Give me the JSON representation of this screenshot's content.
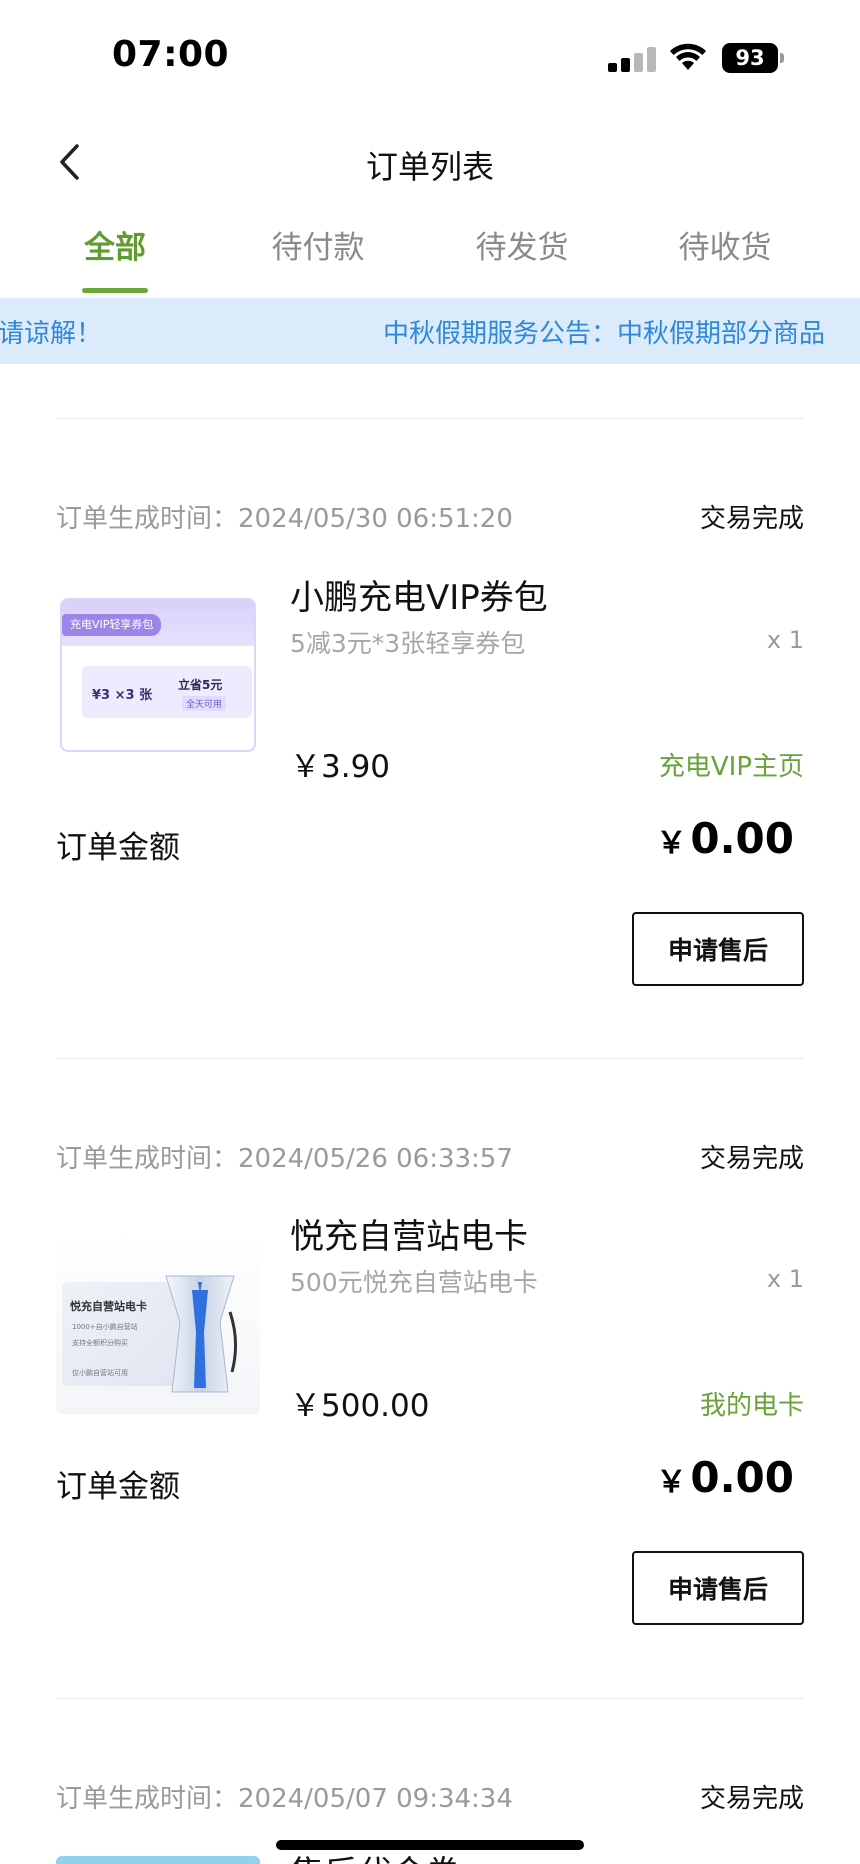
{
  "status_bar": {
    "time": "07:00",
    "battery": "93"
  },
  "nav": {
    "title": "订单列表"
  },
  "tabs": [
    {
      "label": "全部",
      "active": true
    },
    {
      "label": "待付款",
      "active": false
    },
    {
      "label": "待发货",
      "active": false
    },
    {
      "label": "待收货",
      "active": false
    }
  ],
  "notice": {
    "text_tail": "请谅解！",
    "text_head": "中秋假期服务公告：中秋假期部分商品"
  },
  "orders": [
    {
      "time": "订单生成时间：2024/05/30 06:51:20",
      "status": "交易完成",
      "product": "小鹏充电VIP券包",
      "desc": "5减3元*3张轻享券包",
      "qty": "x 1",
      "price": "￥3.90",
      "link": "充电VIP主页",
      "amount_label": "订单金额",
      "amount_currency": "￥",
      "amount_value": "0.00",
      "button": "申请售后",
      "thumb": {
        "tag": "充电VIP轻享券包",
        "coupon_left": "¥3 ×3 张",
        "coupon_right": "立省5元",
        "coupon_note": "全天可用"
      }
    },
    {
      "time": "订单生成时间：2024/05/26 06:33:57",
      "status": "交易完成",
      "product": "悦充自营站电卡",
      "desc": "500元悦充自营站电卡",
      "qty": "x 1",
      "price": "￥500.00",
      "link": "我的电卡",
      "amount_label": "订单金额",
      "amount_currency": "￥",
      "amount_value": "0.00",
      "button": "申请售后",
      "thumb": {
        "title": "悦充自营站电卡",
        "line1": "1000+自小鹏自营站",
        "line2": "支持全额积分购买",
        "line3": "仅小鹏自营站可用"
      }
    },
    {
      "time": "订单生成时间：2024/05/07 09:34:34",
      "status": "交易完成",
      "product": "售后代金券"
    }
  ],
  "colors": {
    "accent_green": "#5f9c2e",
    "notice_bg": "#dcebfb",
    "notice_text": "#2f89d8"
  }
}
